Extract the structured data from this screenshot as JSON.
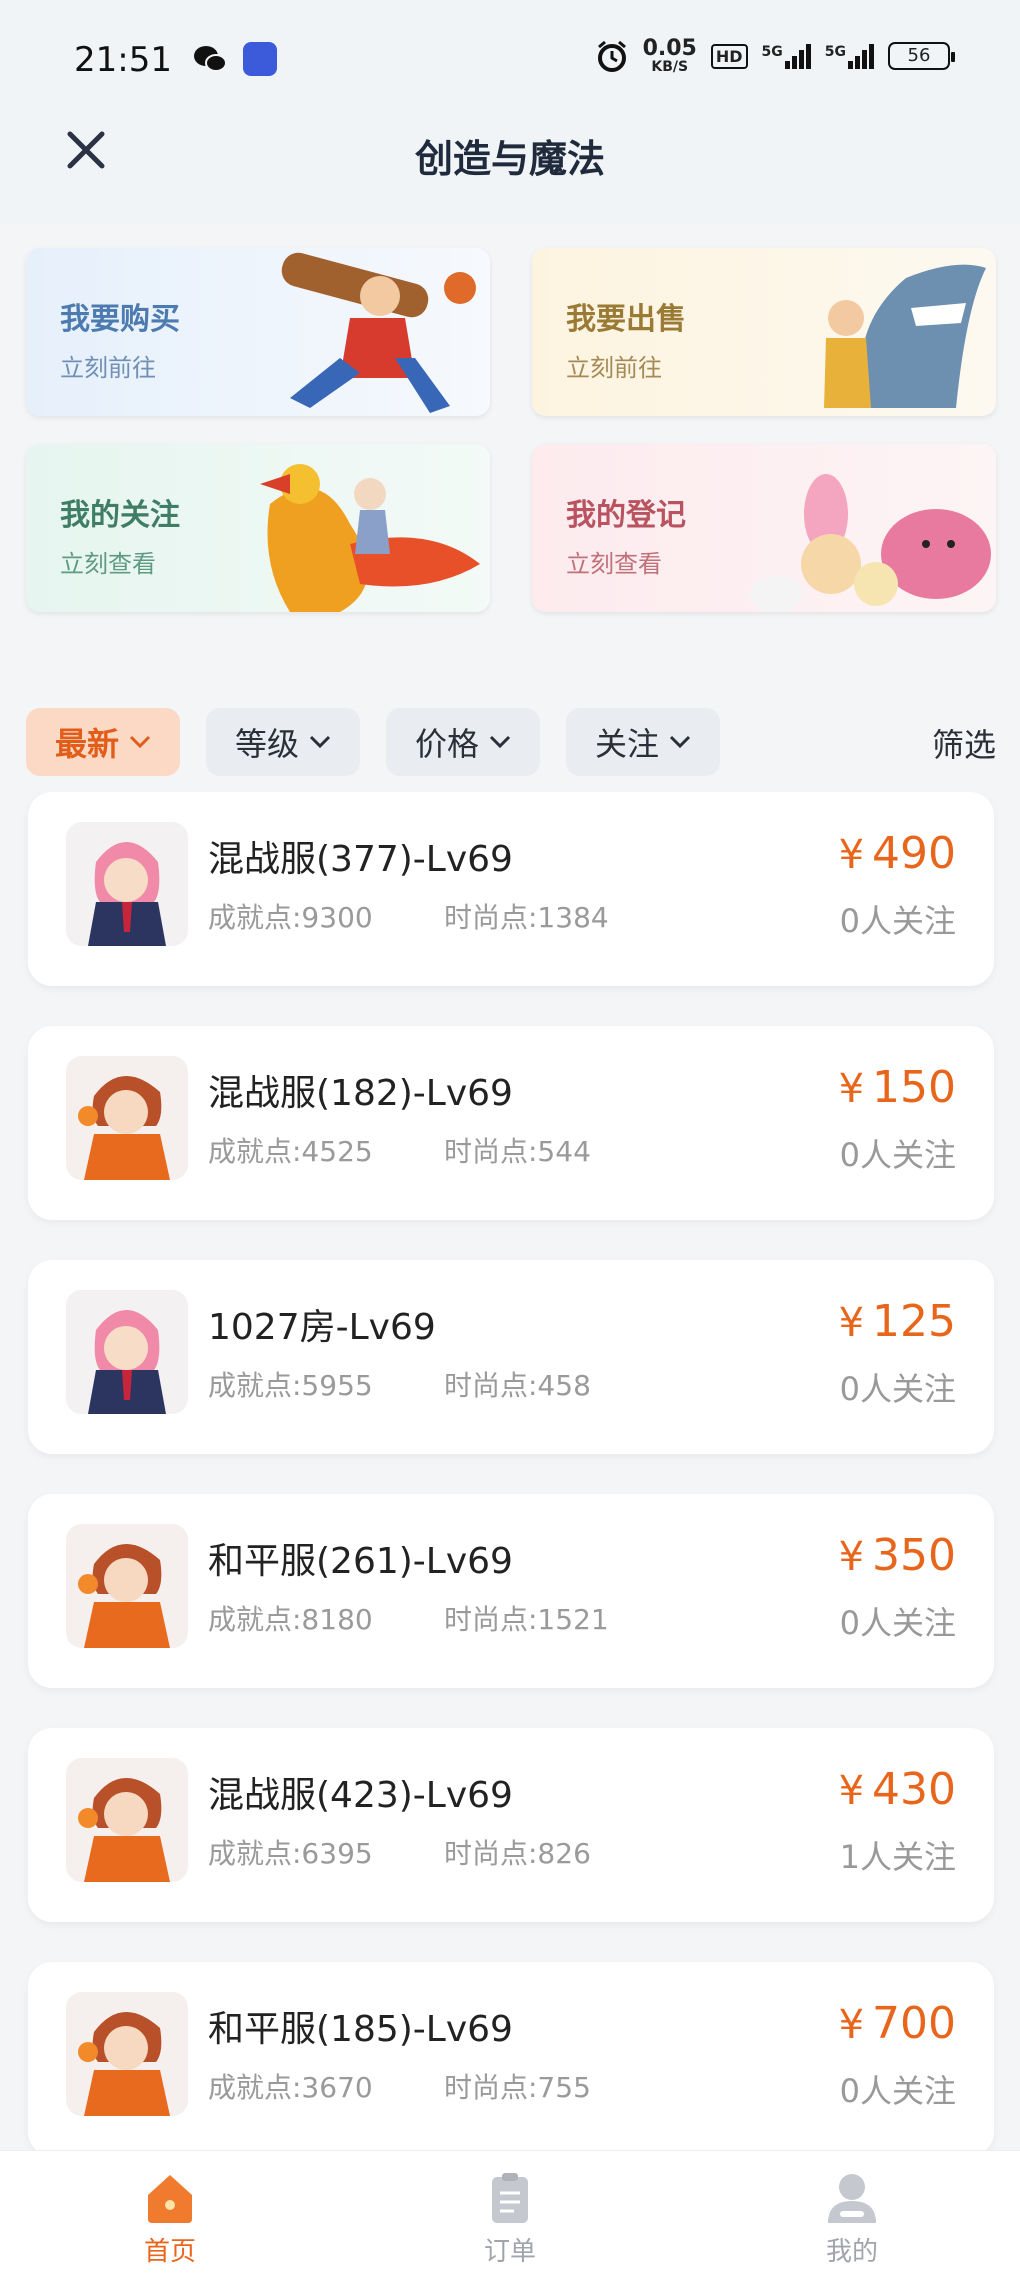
{
  "status_bar": {
    "time": "21:51",
    "speed_value": "0.05",
    "speed_unit": "KB/S",
    "hd": "HD",
    "sig1": "5G",
    "sig2": "5G",
    "battery": "56"
  },
  "nav": {
    "title": "创造与魔法"
  },
  "quick_cards": [
    {
      "title": "我要购买",
      "subtitle": "立刻前往"
    },
    {
      "title": "我要出售",
      "subtitle": "立刻前往"
    },
    {
      "title": "我的关注",
      "subtitle": "立刻查看"
    },
    {
      "title": "我的登记",
      "subtitle": "立刻查看"
    }
  ],
  "filters": {
    "chips": [
      "最新",
      "等级",
      "价格",
      "关注"
    ],
    "filter_label": "筛选"
  },
  "list_items": [
    {
      "title": "混战服(377)-Lv69",
      "achievement": "成就点:9300",
      "fashion": "时尚点:1384",
      "currency": "¥",
      "price": "490",
      "followers": "0人关注",
      "avatar": "pink"
    },
    {
      "title": "混战服(182)-Lv69",
      "achievement": "成就点:4525",
      "fashion": "时尚点:544",
      "currency": "¥",
      "price": "150",
      "followers": "0人关注",
      "avatar": "red"
    },
    {
      "title": "1027房-Lv69",
      "achievement": "成就点:5955",
      "fashion": "时尚点:458",
      "currency": "¥",
      "price": "125",
      "followers": "0人关注",
      "avatar": "pink"
    },
    {
      "title": "和平服(261)-Lv69",
      "achievement": "成就点:8180",
      "fashion": "时尚点:1521",
      "currency": "¥",
      "price": "350",
      "followers": "0人关注",
      "avatar": "red"
    },
    {
      "title": "混战服(423)-Lv69",
      "achievement": "成就点:6395",
      "fashion": "时尚点:826",
      "currency": "¥",
      "price": "430",
      "followers": "1人关注",
      "avatar": "red"
    },
    {
      "title": "和平服(185)-Lv69",
      "achievement": "成就点:3670",
      "fashion": "时尚点:755",
      "currency": "¥",
      "price": "700",
      "followers": "0人关注",
      "avatar": "red"
    }
  ],
  "tab_bar": {
    "home": "首页",
    "orders": "订单",
    "mine": "我的"
  },
  "colors": {
    "accent": "#e8661b",
    "active_chip_bg": "#fbd9c4",
    "title": "#1f2a3c"
  },
  "icons": {
    "close": "close-icon",
    "wechat": "wechat-icon",
    "home": "home-icon",
    "orders": "orders-icon",
    "mine": "user-icon"
  }
}
